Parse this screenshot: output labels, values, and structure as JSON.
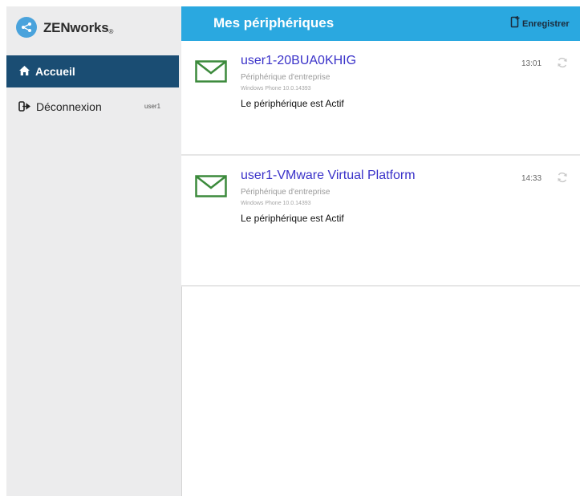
{
  "brand": {
    "name": "ZENworks",
    "mark": "®"
  },
  "sidebar": {
    "items": [
      {
        "label": "Accueil",
        "icon": "home-icon",
        "active": true
      },
      {
        "label": "Déconnexion",
        "icon": "sign-out-icon",
        "user": "user1"
      }
    ]
  },
  "header": {
    "title": "Mes périphériques",
    "enroll_label": "Enregistrer"
  },
  "devices": [
    {
      "name": "user1-20BUA0KHIG",
      "type": "Périphérique d'entreprise",
      "os": "Windows Phone 10.0.14393",
      "status": "Le périphérique est Actif",
      "time": "13:01"
    },
    {
      "name": "user1-VMware Virtual Platform",
      "type": "Périphérique d'entreprise",
      "os": "Windows Phone 10.0.14393",
      "status": "Le périphérique est Actif",
      "time": "14:33"
    }
  ],
  "colors": {
    "header": "#2aa8e0",
    "active_nav": "#1a4d73",
    "device_name": "#3a32c9",
    "mail_icon": "#3c8a3c"
  }
}
